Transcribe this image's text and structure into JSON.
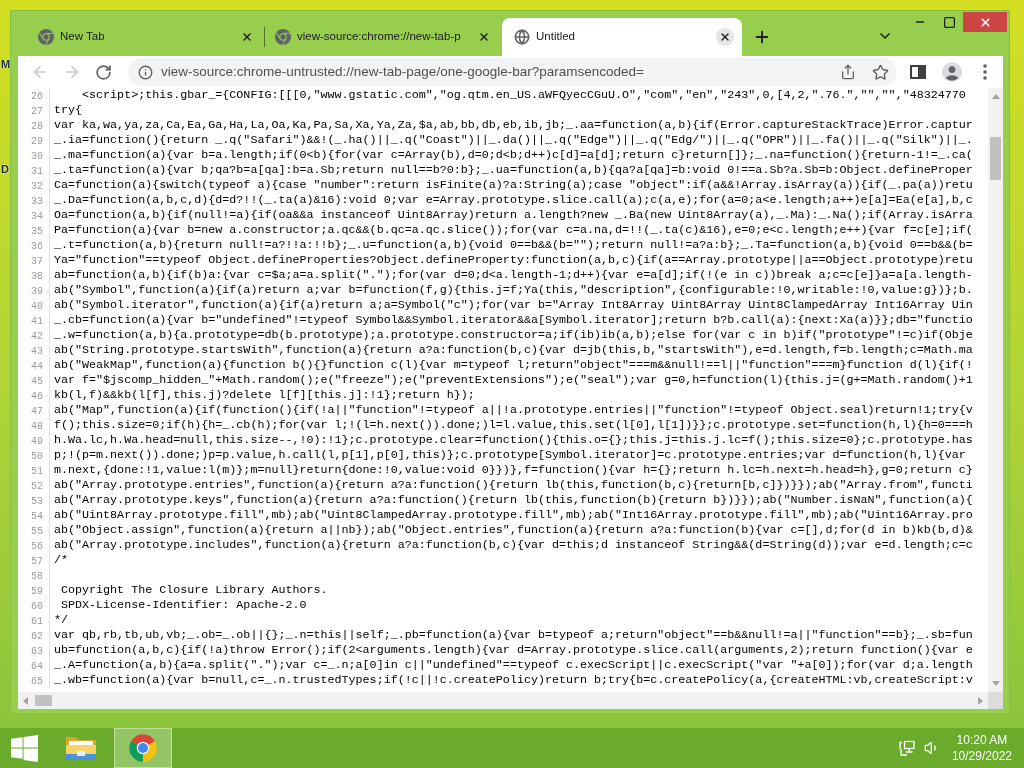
{
  "desktop": {
    "icon_labels": [
      "M",
      "D"
    ]
  },
  "browser": {
    "tabs": [
      {
        "title": "New Tab",
        "kind": "chrome_page",
        "selected": false
      },
      {
        "title": "view-source:chrome://new-tab-p",
        "kind": "chrome_page",
        "selected": false
      },
      {
        "title": "Untitled",
        "kind": "web_page",
        "selected": true
      }
    ],
    "toolbar": {
      "back": {
        "disabled": true
      },
      "forward": {
        "disabled": true
      },
      "url": "view-source:chrome-untrusted://new-tab-page/one-google-bar?paramsencoded="
    }
  },
  "source": {
    "lines": [
      {
        "number": "26",
        "code": "    <script>;this.gbar_={CONFIG:[[[0,\"www.gstatic.com\",\"og.qtm.en_US.aWFQyecCGuU.O\",\"com\",\"en\",\"243\",0,[4,2,\".76.\",\"\",\"\",\"48324770"
      },
      {
        "number": "27",
        "code": "try{"
      },
      {
        "number": "28",
        "code": "var ka,wa,ya,za,Ca,Ea,Ga,Ha,La,Oa,Ka,Pa,Sa,Xa,Ya,Za,$a,ab,bb,db,eb,ib,jb;_.aa=function(a,b){if(Error.captureStackTrace)Error.captur"
      },
      {
        "number": "29",
        "code": "_.ia=function(){return _.q(\"Safari\")&&!(_.ha()||_.q(\"Coast\")||_.da()||_.q(\"Edge\")||_.q(\"Edg/\")||_.q(\"OPR\")||_.fa()||_.q(\"Silk\")||_."
      },
      {
        "number": "30",
        "code": "_.ma=function(a){var b=a.length;if(0<b){for(var c=Array(b),d=0;d<b;d++)c[d]=a[d];return c}return[]};_.na=function(){return-1!=_.ca("
      },
      {
        "number": "31",
        "code": "_.ta=function(a){var b;qa?b=a[qa]:b=a.Sb;return null==b?0:b};_.ua=function(a,b){qa?a[qa]=b:void 0!==a.Sb?a.Sb=b:Object.defineProper"
      },
      {
        "number": "32",
        "code": "Ca=function(a){switch(typeof a){case \"number\":return isFinite(a)?a:String(a);case \"object\":if(a&&!Array.isArray(a)){if(_.pa(a))retu"
      },
      {
        "number": "33",
        "code": "_.Da=function(a,b,c,d){d=d?!!(_.ta(a)&16):void 0;var e=Array.prototype.slice.call(a);c(a,e);for(a=0;a<e.length;a++)e[a]=Ea(e[a],b,c"
      },
      {
        "number": "34",
        "code": "Oa=function(a,b){if(null!=a){if(oa&&a instanceof Uint8Array)return a.length?new _.Ba(new Uint8Array(a),_.Ma):_.Na();if(Array.isArra"
      },
      {
        "number": "35",
        "code": "Pa=function(a){var b=new a.constructor;a.qc&&(b.qc=a.qc.slice());for(var c=a.na,d=!!(_.ta(c)&16),e=0;e<c.length;e++){var f=c[e];if("
      },
      {
        "number": "36",
        "code": "_.t=function(a,b){return null!=a?!!a:!!b};_.u=function(a,b){void 0==b&&(b=\"\");return null!=a?a:b};_.Ta=function(a,b){void 0==b&&(b="
      },
      {
        "number": "37",
        "code": "Ya=\"function\"==typeof Object.defineProperties?Object.defineProperty:function(a,b,c){if(a==Array.prototype||a==Object.prototype)retu"
      },
      {
        "number": "38",
        "code": "ab=function(a,b){if(b)a:{var c=$a;a=a.split(\".\");for(var d=0;d<a.length-1;d++){var e=a[d];if(!(e in c))break a;c=c[e]}a=a[a.length-"
      },
      {
        "number": "39",
        "code": "ab(\"Symbol\",function(a){if(a)return a;var b=function(f,g){this.j=f;Ya(this,\"description\",{configurable:!0,writable:!0,value:g})};b."
      },
      {
        "number": "40",
        "code": "ab(\"Symbol.iterator\",function(a){if(a)return a;a=Symbol(\"c\");for(var b=\"Array Int8Array Uint8Array Uint8ClampedArray Int16Array Uin"
      },
      {
        "number": "41",
        "code": "_.cb=function(a){var b=\"undefined\"!=typeof Symbol&&Symbol.iterator&&a[Symbol.iterator];return b?b.call(a):{next:Xa(a)}};db=\"functio"
      },
      {
        "number": "42",
        "code": "_.w=function(a,b){a.prototype=db(b.prototype);a.prototype.constructor=a;if(ib)ib(a,b);else for(var c in b)if(\"prototype\"!=c)if(Obje"
      },
      {
        "number": "43",
        "code": "ab(\"String.prototype.startsWith\",function(a){return a?a:function(b,c){var d=jb(this,b,\"startsWith\"),e=d.length,f=b.length;c=Math.ma"
      },
      {
        "number": "44",
        "code": "ab(\"WeakMap\",function(a){function b(){}function c(l){var m=typeof l;return\"object\"===m&&null!==l||\"function\"===m}function d(l){if(!"
      },
      {
        "number": "45",
        "code": "var f=\"$jscomp_hidden_\"+Math.random();e(\"freeze\");e(\"preventExtensions\");e(\"seal\");var g=0,h=function(l){this.j=(g+=Math.random()+1"
      },
      {
        "number": "46",
        "code": "kb(l,f)&&kb(l[f],this.j)?delete l[f][this.j]:!1};return h});"
      },
      {
        "number": "47",
        "code": "ab(\"Map\",function(a){if(function(){if(!a||\"function\"!=typeof a||!a.prototype.entries||\"function\"!=typeof Object.seal)return!1;try{v"
      },
      {
        "number": "48",
        "code": "f();this.size=0;if(h){h=_.cb(h);for(var l;!(l=h.next()).done;)l=l.value,this.set(l[0],l[1])}};c.prototype.set=function(h,l){h=0===h"
      },
      {
        "number": "49",
        "code": "h.Wa.lc,h.Wa.head=null,this.size--,!0):!1};c.prototype.clear=function(){this.o={};this.j=this.j.lc=f();this.size=0};c.prototype.has"
      },
      {
        "number": "50",
        "code": "p;!(p=m.next()).done;)p=p.value,h.call(l,p[1],p[0],this)};c.prototype[Symbol.iterator]=c.prototype.entries;var d=function(h,l){var"
      },
      {
        "number": "51",
        "code": "m.next,{done:!1,value:l(m)};m=null}return{done:!0,value:void 0}})},f=function(){var h={};return h.lc=h.next=h.head=h},g=0;return c}"
      },
      {
        "number": "52",
        "code": "ab(\"Array.prototype.entries\",function(a){return a?a:function(){return lb(this,function(b,c){return[b,c]})}});ab(\"Array.from\",functi"
      },
      {
        "number": "53",
        "code": "ab(\"Array.prototype.keys\",function(a){return a?a:function(){return lb(this,function(b){return b})}});ab(\"Number.isNaN\",function(a){"
      },
      {
        "number": "54",
        "code": "ab(\"Uint8Array.prototype.fill\",mb);ab(\"Uint8ClampedArray.prototype.fill\",mb);ab(\"Int16Array.prototype.fill\",mb);ab(\"Uint16Array.pro"
      },
      {
        "number": "55",
        "code": "ab(\"Object.assign\",function(a){return a||nb});ab(\"Object.entries\",function(a){return a?a:function(b){var c=[],d;for(d in b)kb(b,d)&"
      },
      {
        "number": "56",
        "code": "ab(\"Array.prototype.includes\",function(a){return a?a:function(b,c){var d=this;d instanceof String&&(d=String(d));var e=d.length;c=c"
      },
      {
        "number": "57",
        "code": "/*"
      },
      {
        "number": "58"
      },
      {
        "number": "59",
        "code": " Copyright The Closure Library Authors."
      },
      {
        "number": "60",
        "code": " SPDX-License-Identifier: Apache-2.0"
      },
      {
        "number": "61",
        "code": "*/"
      },
      {
        "number": "62",
        "code": "var qb,rb,tb,ub,vb;_.ob=_.ob||{};_.n=this||self;_.pb=function(a){var b=typeof a;return\"object\"==b&&null!=a||\"function\"==b};_.sb=fun"
      },
      {
        "number": "63",
        "code": "ub=function(a,b,c){if(!a)throw Error();if(2<arguments.length){var d=Array.prototype.slice.call(arguments,2);return function(){var e"
      },
      {
        "number": "64",
        "code": "_.A=function(a,b){a=a.split(\".\");var c=_.n;a[0]in c||\"undefined\"==typeof c.execScript||c.execScript(\"var \"+a[0]);for(var d;a.length"
      },
      {
        "number": "65",
        "code": "_.wb=function(a){var b=null,c=_.n.trustedTypes;if(!c||!c.createPolicy)return b;try{b=c.createPolicy(a,{createHTML:vb,createScript:v"
      }
    ]
  },
  "taskbar": {
    "apps": [
      {
        "kind": "file_explorer",
        "selected": false
      },
      {
        "kind": "chrome",
        "selected": true
      }
    ],
    "time": "10:20 AM",
    "date": "10/29/2022"
  }
}
